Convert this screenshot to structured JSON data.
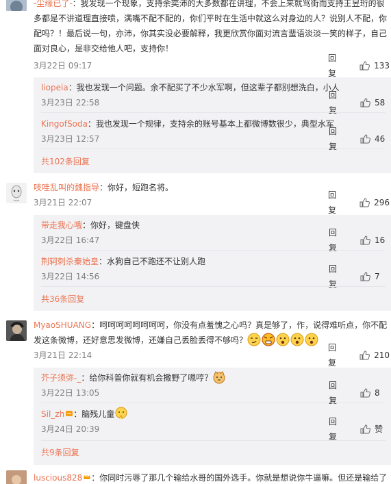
{
  "labels": {
    "reply": "回复"
  },
  "comments": [
    {
      "user": "-尘缘已了-",
      "text": "：我发现一个现象，支持余奕沛的大多数都在讲理，不会上来就骂街而支持王昱珩的很多都是不讲道理直接喷，满嘴不配不配的，你们平时在生活中就这么对身边的人？说别人不配，你配吗？！最后说一句，亦沛，你其实没必要解释，我更欣赏你面对流言蜚语淡淡一笑的样子，自己面对良心，是非交给他人吧，支持你！",
      "time": "3月22日 09:17",
      "likes": "133",
      "replies": [
        {
          "user": "liopeia",
          "text": "：我也发现一个问题。余不配买了不少水军啊，但这辈子都别想洗白，小人",
          "time": "3月23日 22:58",
          "likes": "58"
        },
        {
          "user": "KingofSoda",
          "text": "：我也发现一个规律，支持余的账号基本上都微博数很少，典型水军",
          "time": "3月23日 12:57",
          "likes": "46"
        }
      ],
      "more": "共102条回复"
    },
    {
      "user": "吱哇乱叫的魏指导",
      "text": "：你好，短跑名将。",
      "time": "3月21日 22:07",
      "likes": "296",
      "replies": [
        {
          "user": "带走我心哦",
          "text": "：你好，键盘侠",
          "time": "3月22日 16:47",
          "likes": "16"
        },
        {
          "user": "荆轲刺杀秦始皇",
          "text": "：水狗自己不跑还不让别人跑",
          "time": "3月22日 14:56",
          "likes": "7"
        }
      ],
      "more": "共36条回复"
    },
    {
      "user": "MyaoSHUANG",
      "text": "：呵呵呵呵呵呵呵呵，你没有点羞愧之心吗？真是够了，作，说得难听点，你不配发这条微博，还好意思发微博，还嫌自己丢脸丢得不够吗？",
      "time": "3月21日 22:14",
      "likes": "210",
      "replies": [
        {
          "user": "芥子须弥-_",
          "text": "：给你科普你就有机会撒野了嗯哼？",
          "time": "3月22日 13:05",
          "likes": "8"
        },
        {
          "user": "Sil_zh",
          "text": "：脑残儿童",
          "time": "3月24日 20:39",
          "likes": "赞"
        }
      ],
      "more": "共9条回复"
    },
    {
      "user": "luscious828",
      "text": "：你同时污辱了那几个输给水哥的国外选手。你就是想说你牛逼嘛。但还是输给了",
      "time": "",
      "likes": "",
      "replies": [],
      "more": ""
    }
  ],
  "colors": {
    "username": "#eb7350",
    "reply_bg": "#f2f2f5",
    "time": "#808080"
  }
}
